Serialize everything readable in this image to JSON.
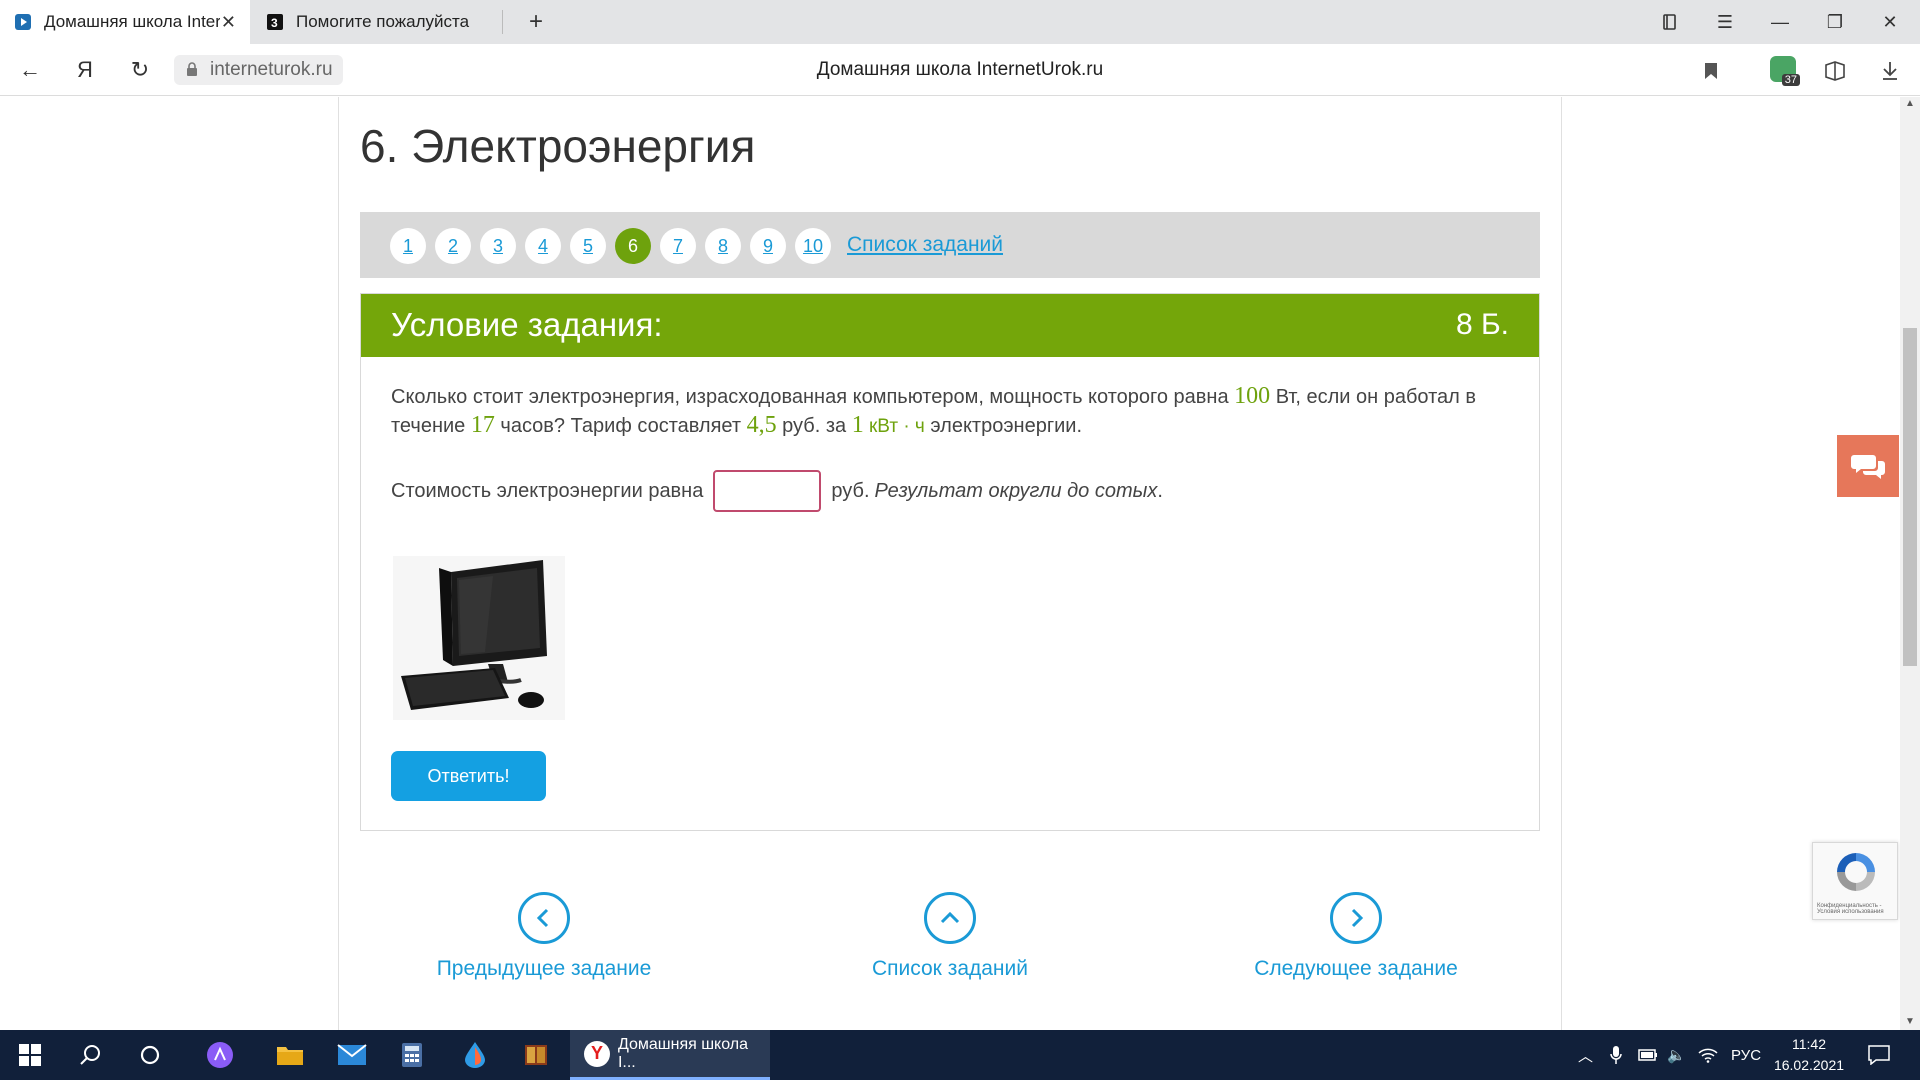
{
  "browser": {
    "tabs": [
      {
        "label": "Домашняя школа InternetUrok.ru"
      },
      {
        "label": "Помогите пожалуйста срочно"
      }
    ],
    "url": "interneturok.ru",
    "page_title": "Домашняя школа InternetUrok.ru",
    "extension_badge": "37"
  },
  "page": {
    "heading": "6. Электроэнергия",
    "pager": {
      "numbers": [
        "1",
        "2",
        "3",
        "4",
        "5",
        "6",
        "7",
        "8",
        "9",
        "10"
      ],
      "active_index": 5,
      "list_link": "Список заданий"
    },
    "task": {
      "header_title": "Условие задания:",
      "points": "8 Б.",
      "q_part1": "Сколько стоит электроэнергия, израсходованная компьютером, мощность которого равна ",
      "power": "100",
      "q_part2": " Вт, если он работал в течение ",
      "hours": "17",
      "q_part3": " часов? Тариф составляет ",
      "tariff": "4,5",
      "q_part4": " руб. за ",
      "one": "1",
      "unit": " кВт · ч",
      "q_part5": " электроэнергии.",
      "answer_label": "Стоимость электроэнергии равна",
      "answer_value": "",
      "answer_suffix": "руб.",
      "answer_note": "Результат округли до сотых",
      "answer_note_end": ".",
      "submit": "Ответить!"
    },
    "bottom_nav": {
      "prev": "Предыдущее задание",
      "list": "Список заданий",
      "next": "Следующее задание"
    },
    "recaptcha_text": "Конфиденциальность - Условия использования"
  },
  "taskbar": {
    "active_window": "Домашняя школа I...",
    "lang": "РУС",
    "time": "11:42",
    "date": "16.02.2021"
  },
  "colors": {
    "accent_green": "#74a60a",
    "link_blue": "#1a9ad6",
    "button_blue": "#14a0e2",
    "chat_orange": "#e6775a"
  }
}
